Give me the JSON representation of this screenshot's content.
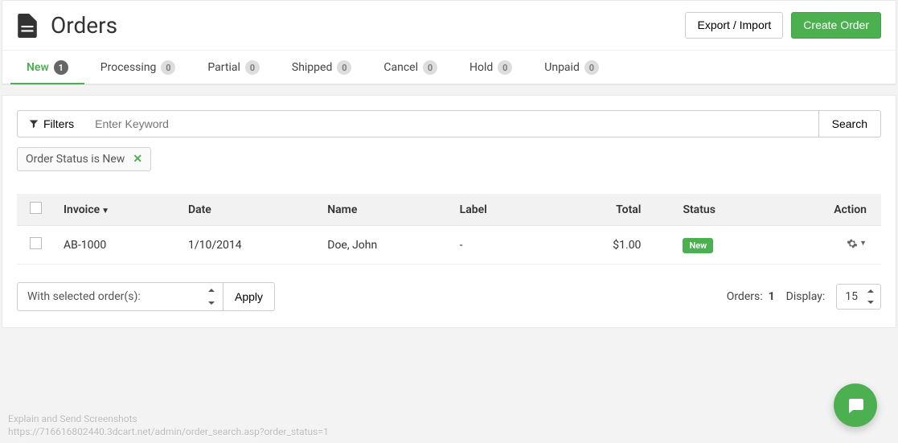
{
  "header": {
    "title": "Orders",
    "export_label": "Export / Import",
    "create_label": "Create Order"
  },
  "tabs": [
    {
      "label": "New",
      "count": "1",
      "active": true
    },
    {
      "label": "Processing",
      "count": "0",
      "active": false
    },
    {
      "label": "Partial",
      "count": "0",
      "active": false
    },
    {
      "label": "Shipped",
      "count": "0",
      "active": false
    },
    {
      "label": "Cancel",
      "count": "0",
      "active": false
    },
    {
      "label": "Hold",
      "count": "0",
      "active": false
    },
    {
      "label": "Unpaid",
      "count": "0",
      "active": false
    }
  ],
  "search": {
    "filters_label": "Filters",
    "placeholder": "Enter Keyword",
    "search_label": "Search"
  },
  "active_filter": {
    "text": "Order Status is New"
  },
  "table": {
    "columns": {
      "invoice": "Invoice",
      "date": "Date",
      "name": "Name",
      "label": "Label",
      "total": "Total",
      "status": "Status",
      "action": "Action"
    },
    "rows": [
      {
        "invoice": "AB-1000",
        "date": "1/10/2014",
        "name": "Doe, John",
        "label": "-",
        "total": "$1.00",
        "status": "New"
      }
    ]
  },
  "footer": {
    "bulk_placeholder": "With selected order(s):",
    "apply_label": "Apply",
    "orders_label": "Orders:",
    "orders_count": "1",
    "display_label": "Display:",
    "display_value": "15"
  },
  "status_bar": {
    "line1": "Explain and Send Screenshots",
    "line2": "https://716616802440.3dcart.net/admin/order_search.asp?order_status=1"
  }
}
